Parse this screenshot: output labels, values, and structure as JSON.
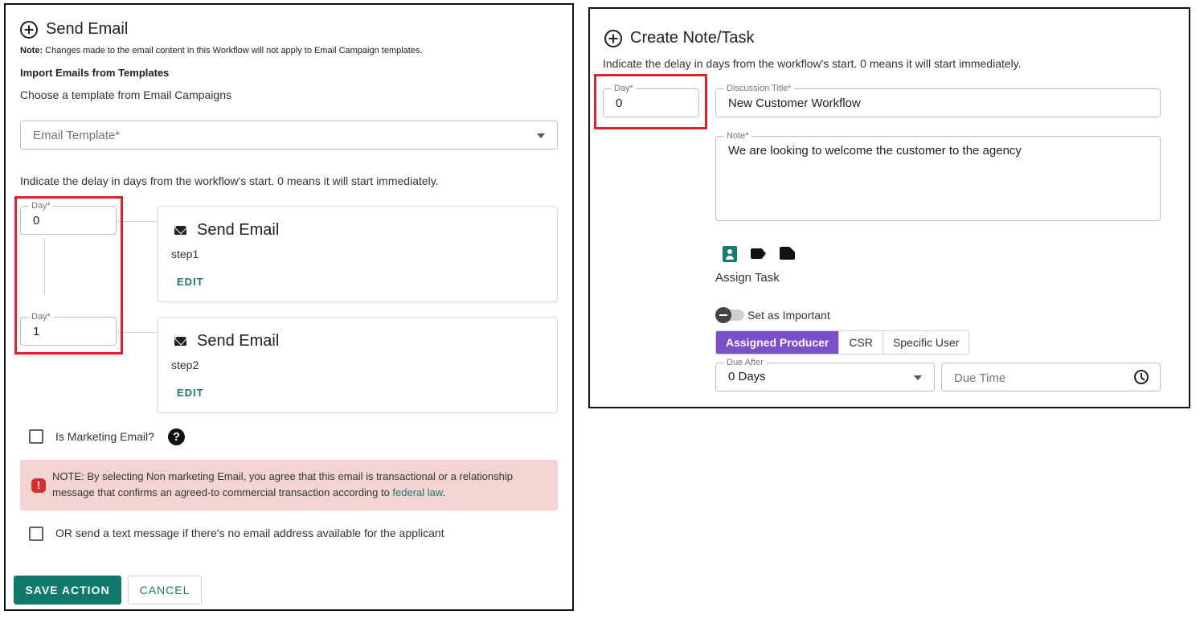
{
  "send_email": {
    "title": "Send Email",
    "note_label": "Note:",
    "note_text": " Changes made to the email content in this Workflow will not apply to Email Campaign templates.",
    "import_heading": "Import Emails from Templates",
    "choose_template": "Choose a template from Email Campaigns",
    "template_placeholder": "Email Template*",
    "delay_hint": "Indicate the delay in days from the workflow's start. 0 means it will start immediately.",
    "steps": [
      {
        "day_label": "Day*",
        "day_value": "0",
        "title": "Send Email",
        "subtitle": "step1",
        "edit_label": "EDIT"
      },
      {
        "day_label": "Day*",
        "day_value": "1",
        "title": "Send Email",
        "subtitle": "step2",
        "edit_label": "EDIT"
      }
    ],
    "marketing_label": "Is Marketing Email?",
    "help_glyph": "?",
    "alert_text": "NOTE: By selecting Non marketing Email, you agree that this email is transactional or a relationship message that confirms an agreed-to commercial transaction according to ",
    "alert_link": "federal law",
    "alert_end": ".",
    "alert_icon_glyph": "!",
    "sms_label": "OR send a text message if there's no email address available for the applicant",
    "save_label": "SAVE ACTION",
    "cancel_label": "CANCEL"
  },
  "create_note": {
    "title": "Create Note/Task",
    "delay_hint": "Indicate the delay in days from the workflow's start. 0 means it will start immediately.",
    "day_label": "Day*",
    "day_value": "0",
    "discussion_label": "Discussion Title*",
    "discussion_value": "New Customer Workflow",
    "note_label": "Note*",
    "note_value": "We are looking to welcome the customer to the agency",
    "icons": [
      "assign-task-icon",
      "tag-icon",
      "note-icon"
    ],
    "assign_task_label": "Assign Task",
    "important_label": "Set as Important",
    "assign_options": [
      "Assigned Producer",
      "CSR",
      "Specific User"
    ],
    "due_after_label": "Due After",
    "due_after_value": "0 Days",
    "due_time_placeholder": "Due Time"
  },
  "colors": {
    "primary": "#0f7a6b",
    "active_segment": "#7b4fc9",
    "highlight_border": "#e01f26",
    "alert_bg": "#f4d3d3"
  }
}
